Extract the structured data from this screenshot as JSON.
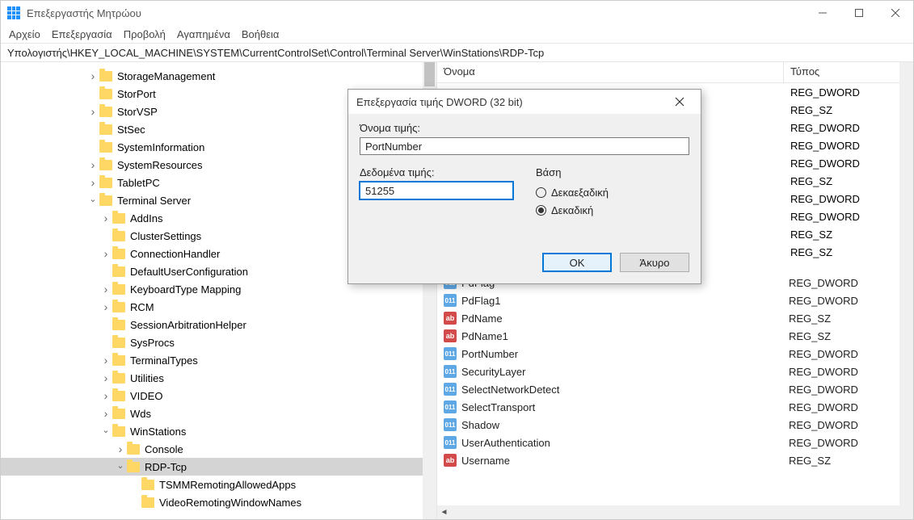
{
  "window": {
    "title": "Επεξεργαστής Μητρώου"
  },
  "menu": {
    "file": "Αρχείο",
    "edit": "Επεξεργασία",
    "view": "Προβολή",
    "favorites": "Αγαπημένα",
    "help": "Βοήθεια"
  },
  "path": "Υπολογιστής\\HKEY_LOCAL_MACHINE\\SYSTEM\\CurrentControlSet\\Control\\Terminal Server\\WinStations\\RDP-Tcp",
  "tree": {
    "n0": "StorageManagement",
    "n1": "StorPort",
    "n2": "StorVSP",
    "n3": "StSec",
    "n4": "SystemInformation",
    "n5": "SystemResources",
    "n6": "TabletPC",
    "n7": "Terminal Server",
    "n8": "AddIns",
    "n9": "ClusterSettings",
    "n10": "ConnectionHandler",
    "n11": "DefaultUserConfiguration",
    "n12": "KeyboardType Mapping",
    "n13": "RCM",
    "n14": "SessionArbitrationHelper",
    "n15": "SysProcs",
    "n16": "TerminalTypes",
    "n17": "Utilities",
    "n18": "VIDEO",
    "n19": "Wds",
    "n20": "WinStations",
    "n21": "Console",
    "n22": "RDP-Tcp",
    "n23": "TSMMRemotingAllowedApps",
    "n24": "VideoRemotingWindowNames"
  },
  "columns": {
    "name": "Όνομα",
    "type": "Τύπος"
  },
  "values": [
    {
      "icon": "bin",
      "name": "PdFlag",
      "type": "REG_DWORD"
    },
    {
      "icon": "bin",
      "name": "PdFlag1",
      "type": "REG_DWORD"
    },
    {
      "icon": "str",
      "name": "PdName",
      "type": "REG_SZ"
    },
    {
      "icon": "str",
      "name": "PdName1",
      "type": "REG_SZ"
    },
    {
      "icon": "bin",
      "name": "PortNumber",
      "type": "REG_DWORD"
    },
    {
      "icon": "bin",
      "name": "SecurityLayer",
      "type": "REG_DWORD"
    },
    {
      "icon": "bin",
      "name": "SelectNetworkDetect",
      "type": "REG_DWORD"
    },
    {
      "icon": "bin",
      "name": "SelectTransport",
      "type": "REG_DWORD"
    },
    {
      "icon": "bin",
      "name": "Shadow",
      "type": "REG_DWORD"
    },
    {
      "icon": "bin",
      "name": "UserAuthentication",
      "type": "REG_DWORD"
    },
    {
      "icon": "str",
      "name": "Username",
      "type": "REG_SZ"
    }
  ],
  "hidden_types": [
    "REG_DWORD",
    "REG_SZ",
    "REG_DWORD",
    "REG_DWORD",
    "REG_DWORD",
    "REG_SZ",
    "REG_DWORD",
    "REG_DWORD",
    "REG_SZ",
    "REG_SZ"
  ],
  "dialog": {
    "title": "Επεξεργασία τιμής DWORD (32 bit)",
    "name_label": "Όνομα τιμής:",
    "name_value": "PortNumber",
    "data_label": "Δεδομένα τιμής:",
    "data_value": "51255",
    "base_label": "Βάση",
    "hex_label": "Δεκαεξαδική",
    "dec_label": "Δεκαδική",
    "ok": "OK",
    "cancel": "Άκυρο"
  }
}
